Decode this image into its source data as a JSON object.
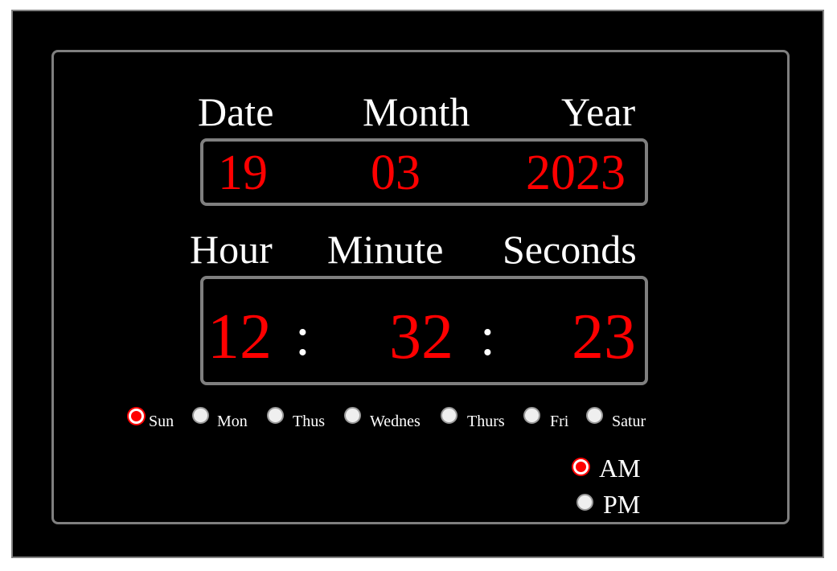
{
  "date_section": {
    "labels": {
      "date": "Date",
      "month": "Month",
      "year": "Year"
    },
    "values": {
      "date": "19",
      "month": "03",
      "year": "2023"
    }
  },
  "time_section": {
    "labels": {
      "hour": "Hour",
      "minute": "Minute",
      "seconds": "Seconds"
    },
    "values": {
      "hour": "12",
      "minute": "32",
      "seconds": "23"
    },
    "separator": ":"
  },
  "days": {
    "selected": "Sun",
    "options": [
      "Sun",
      "Mon",
      "Thus",
      "Wednes",
      "Thurs",
      "Fri",
      "Satur"
    ]
  },
  "meridiem": {
    "selected": "AM",
    "options": [
      "AM",
      "PM"
    ]
  },
  "colors": {
    "background": "#000000",
    "digits": "#ff0000",
    "labels": "#ffffff",
    "border": "#7f7f7f",
    "selected_radio": "#ff0000"
  }
}
